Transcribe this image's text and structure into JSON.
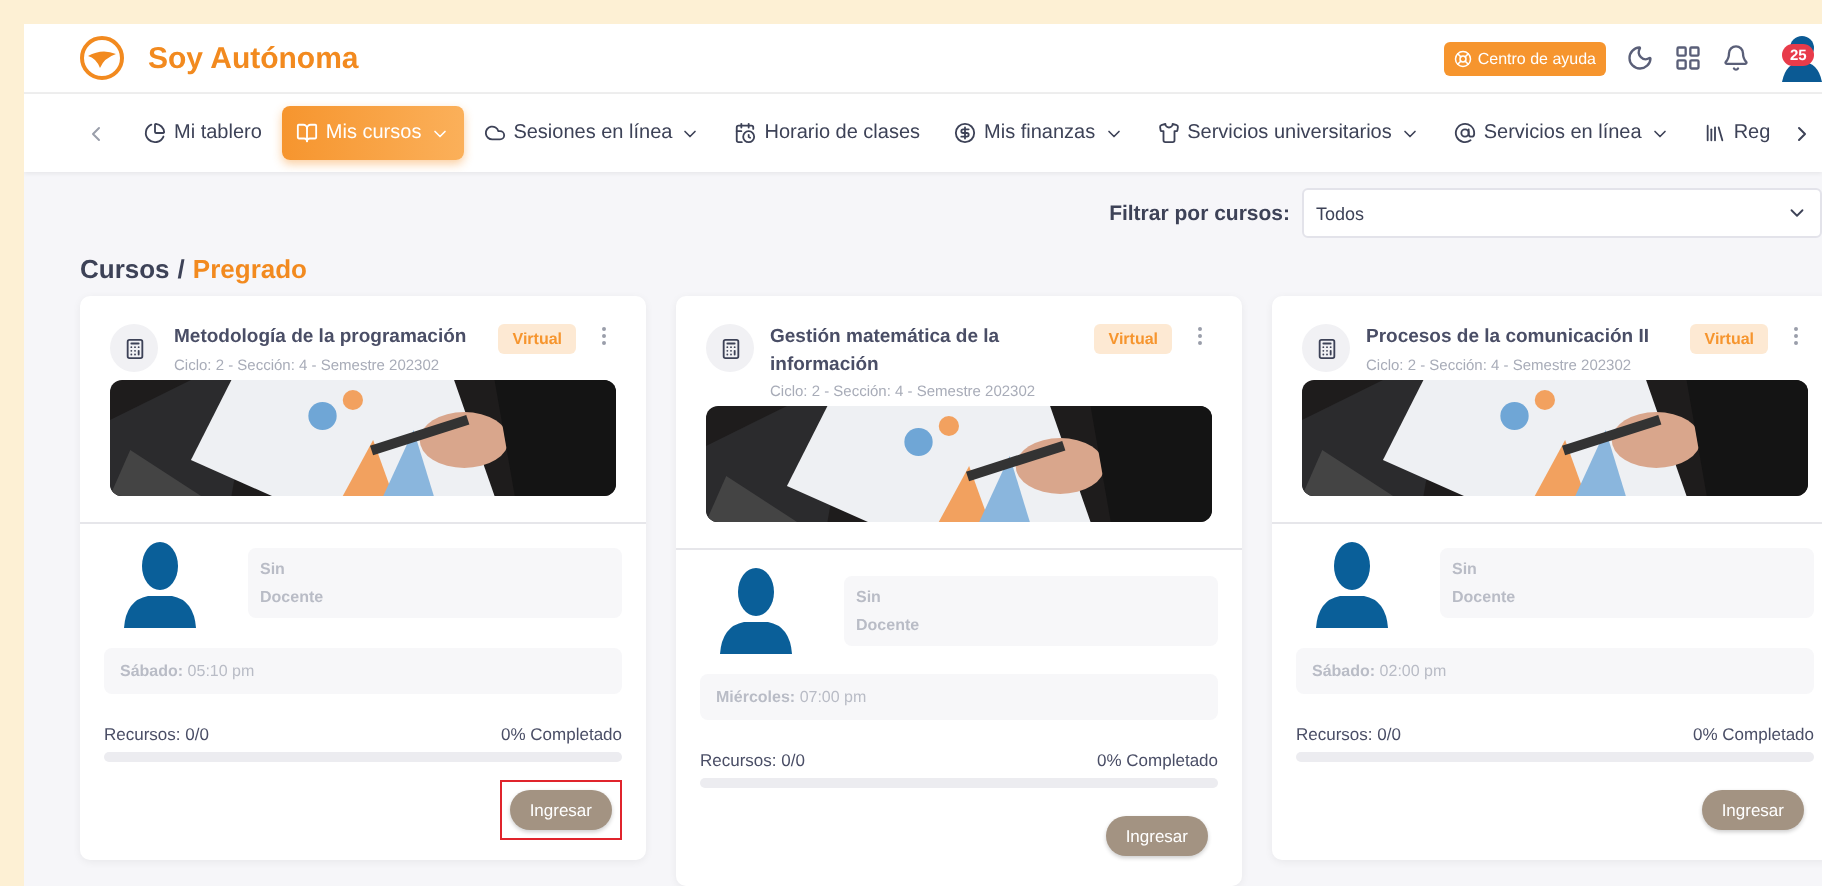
{
  "header": {
    "brand": "Soy Autónoma",
    "help_button": "Centro de ayuda",
    "notification_count": "25"
  },
  "nav": {
    "items": [
      {
        "label": "Mi tablero",
        "selected": false,
        "dropdown": false
      },
      {
        "label": "Mis cursos",
        "selected": true,
        "dropdown": true
      },
      {
        "label": "Sesiones en línea",
        "selected": false,
        "dropdown": true
      },
      {
        "label": "Horario de clases",
        "selected": false,
        "dropdown": false
      },
      {
        "label": "Mis finanzas",
        "selected": false,
        "dropdown": true
      },
      {
        "label": "Servicios universitarios",
        "selected": false,
        "dropdown": true
      },
      {
        "label": "Servicios en línea",
        "selected": false,
        "dropdown": true
      },
      {
        "label": "Reg",
        "selected": false,
        "dropdown": false
      }
    ]
  },
  "filter": {
    "label": "Filtrar por cursos:",
    "value": "Todos"
  },
  "breadcrumb": {
    "section": "Cursos",
    "separator": "/",
    "current": "Pregrado"
  },
  "courses": [
    {
      "title": "Metodología de la programación",
      "meta": "Ciclo: 2 - Sección: 4 - Semestre 202302",
      "badge": "Virtual",
      "teacher": [
        "Sin",
        "Docente"
      ],
      "day": "Sábado:",
      "time": "05:10 pm",
      "resources": "Recursos: 0/0",
      "completed": "0% Completado",
      "level": 0,
      "button": "Ingresar",
      "highlighted": true
    },
    {
      "title": "Gestión matemática de la información",
      "meta": "Ciclo: 2 - Sección: 4 - Semestre 202302",
      "badge": "Virtual",
      "teacher": [
        "Sin",
        "Docente"
      ],
      "day": "Miércoles:",
      "time": "07:00 pm",
      "resources": "Recursos: 0/0",
      "completed": "0% Completado",
      "level": 0,
      "button": "Ingresar",
      "highlighted": false
    },
    {
      "title": "Procesos de la comunicación II",
      "meta": "Ciclo: 2 - Sección: 4 - Semestre 202302",
      "badge": "Virtual",
      "teacher": [
        "Sin",
        "Docente"
      ],
      "day": "Sábado:",
      "time": "02:00 pm",
      "resources": "Recursos: 0/0",
      "completed": "0% Completado",
      "level": 0,
      "button": "Ingresar",
      "highlighted": false
    }
  ]
}
